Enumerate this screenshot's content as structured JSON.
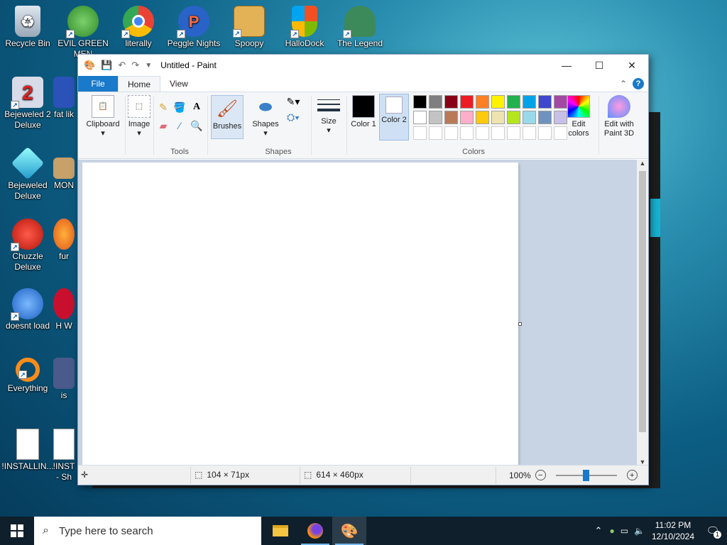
{
  "desktop": {
    "icons": [
      {
        "label": "Recycle Bin",
        "icon": "recycle-bin-icon"
      },
      {
        "label": "EVIL GREEN MEN",
        "icon": "green-men-icon"
      },
      {
        "label": "literally",
        "icon": "chrome-icon"
      },
      {
        "label": "Peggle Nights",
        "icon": "peggle-icon"
      },
      {
        "label": "Spoopy",
        "icon": "folder-icon"
      },
      {
        "label": "HalloDock",
        "icon": "shield-icon"
      },
      {
        "label": "The Legend",
        "icon": "legend-icon"
      },
      {
        "label": "Bejeweled 2 Deluxe",
        "icon": "bejeweled2-icon"
      },
      {
        "label": "fat lik",
        "icon": "app-icon"
      },
      {
        "label": "Bejeweled Deluxe",
        "icon": "diamond-icon"
      },
      {
        "label": "MON",
        "icon": "app-icon"
      },
      {
        "label": "Chuzzle Deluxe",
        "icon": "chuzzle-icon"
      },
      {
        "label": "fur",
        "icon": "firefox-icon"
      },
      {
        "label": "doesnt load",
        "icon": "thunderbird-icon"
      },
      {
        "label": "H W",
        "icon": "app-icon"
      },
      {
        "label": "Everything",
        "icon": "everything-icon"
      },
      {
        "label": "is",
        "icon": "app-icon"
      },
      {
        "label": "!INSTALLIN...",
        "icon": "document-icon"
      },
      {
        "label": "!INST - Sh",
        "icon": "document-icon"
      }
    ]
  },
  "paint": {
    "title": "Untitled - Paint",
    "tabs": {
      "file": "File",
      "home": "Home",
      "view": "View"
    },
    "ribbon": {
      "clipboard": "Clipboard",
      "image": "Image",
      "tools": "Tools",
      "brushes": "Brushes",
      "shapes_btn": "Shapes",
      "shapes_group": "Shapes",
      "size": "Size",
      "color1": "Color 1",
      "color2": "Color 2",
      "colors_group": "Colors",
      "edit_colors": "Edit colors",
      "paint3d": "Edit with Paint 3D"
    },
    "palette_row1": [
      "#000000",
      "#7f7f7f",
      "#880015",
      "#ed1c24",
      "#ff7f27",
      "#fff200",
      "#22b14c",
      "#00a2e8",
      "#3f48cc",
      "#a349a4"
    ],
    "palette_row2": [
      "#ffffff",
      "#c3c3c3",
      "#b97a57",
      "#ffaec9",
      "#ffc90e",
      "#efe4b0",
      "#b5e61d",
      "#99d9ea",
      "#7092be",
      "#c8bfe7"
    ],
    "status": {
      "selection": "104 × 71px",
      "canvas_size": "614 × 460px",
      "zoom": "100%"
    }
  },
  "taskbar": {
    "search_placeholder": "Type here to search",
    "time": "11:02 PM",
    "date": "12/10/2024",
    "notifications": "1"
  }
}
